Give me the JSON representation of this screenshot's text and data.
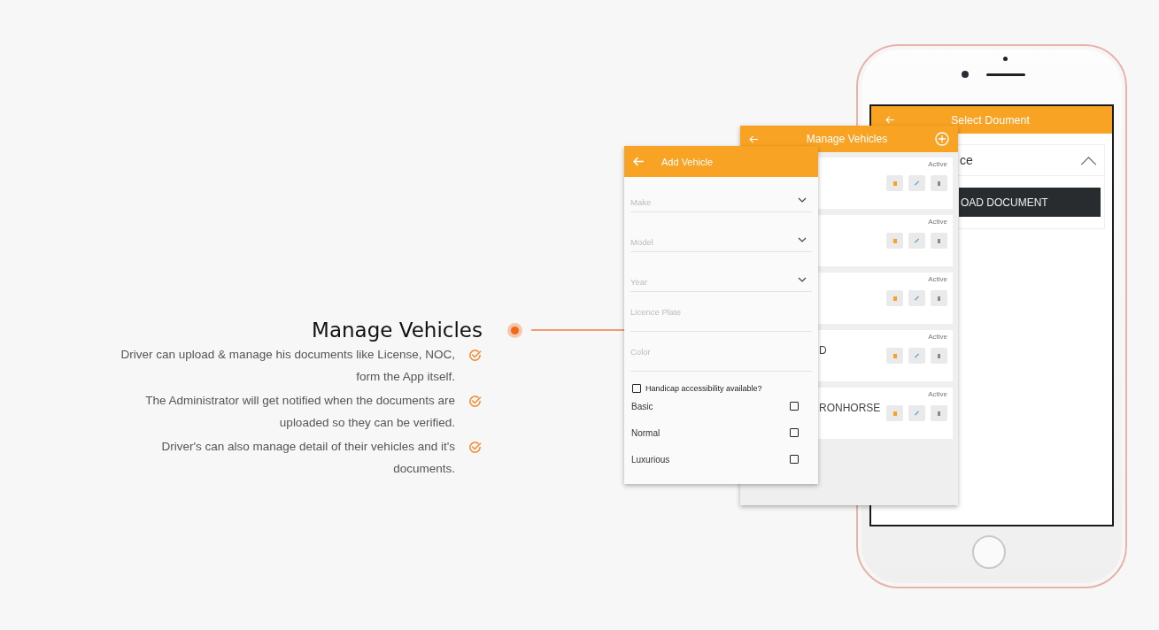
{
  "section": {
    "title": "Manage Vehicles",
    "features": [
      {
        "text": "Driver can upload & manage his documents like License, NOC, form the App itself."
      },
      {
        "text": "The Administrator will get notified when the documents are uploaded so they can be verified."
      },
      {
        "text": "Driver's can also manage detail of their vehicles and it's documents."
      }
    ]
  },
  "select_document": {
    "title": "Select Doument",
    "dropdown_value": "ce",
    "expanded": true,
    "button": "OAD DOCUMENT"
  },
  "manage_vehicles": {
    "title": "Manage Vehicles",
    "vehicles": [
      {
        "status": "Active"
      },
      {
        "status": "Active"
      },
      {
        "status": "Active"
      },
      {
        "name": "D",
        "status": "Active"
      },
      {
        "name": "RONHORSE",
        "status": "Active"
      }
    ]
  },
  "add_vehicle": {
    "title": "Add Vehicle",
    "fields": [
      {
        "placeholder": "Make",
        "kind": "dropdown"
      },
      {
        "placeholder": "Model",
        "kind": "dropdown"
      },
      {
        "placeholder": "Year",
        "kind": "dropdown"
      },
      {
        "placeholder": "Licence Plate",
        "kind": "text"
      },
      {
        "placeholder": "Color",
        "kind": "text"
      }
    ],
    "handicap": {
      "label": "Handicap accessibility available?",
      "checked": false
    },
    "categories": [
      {
        "label": "Basic",
        "checked": false
      },
      {
        "label": "Normal",
        "checked": false
      },
      {
        "label": "Luxurious",
        "checked": false
      }
    ]
  }
}
